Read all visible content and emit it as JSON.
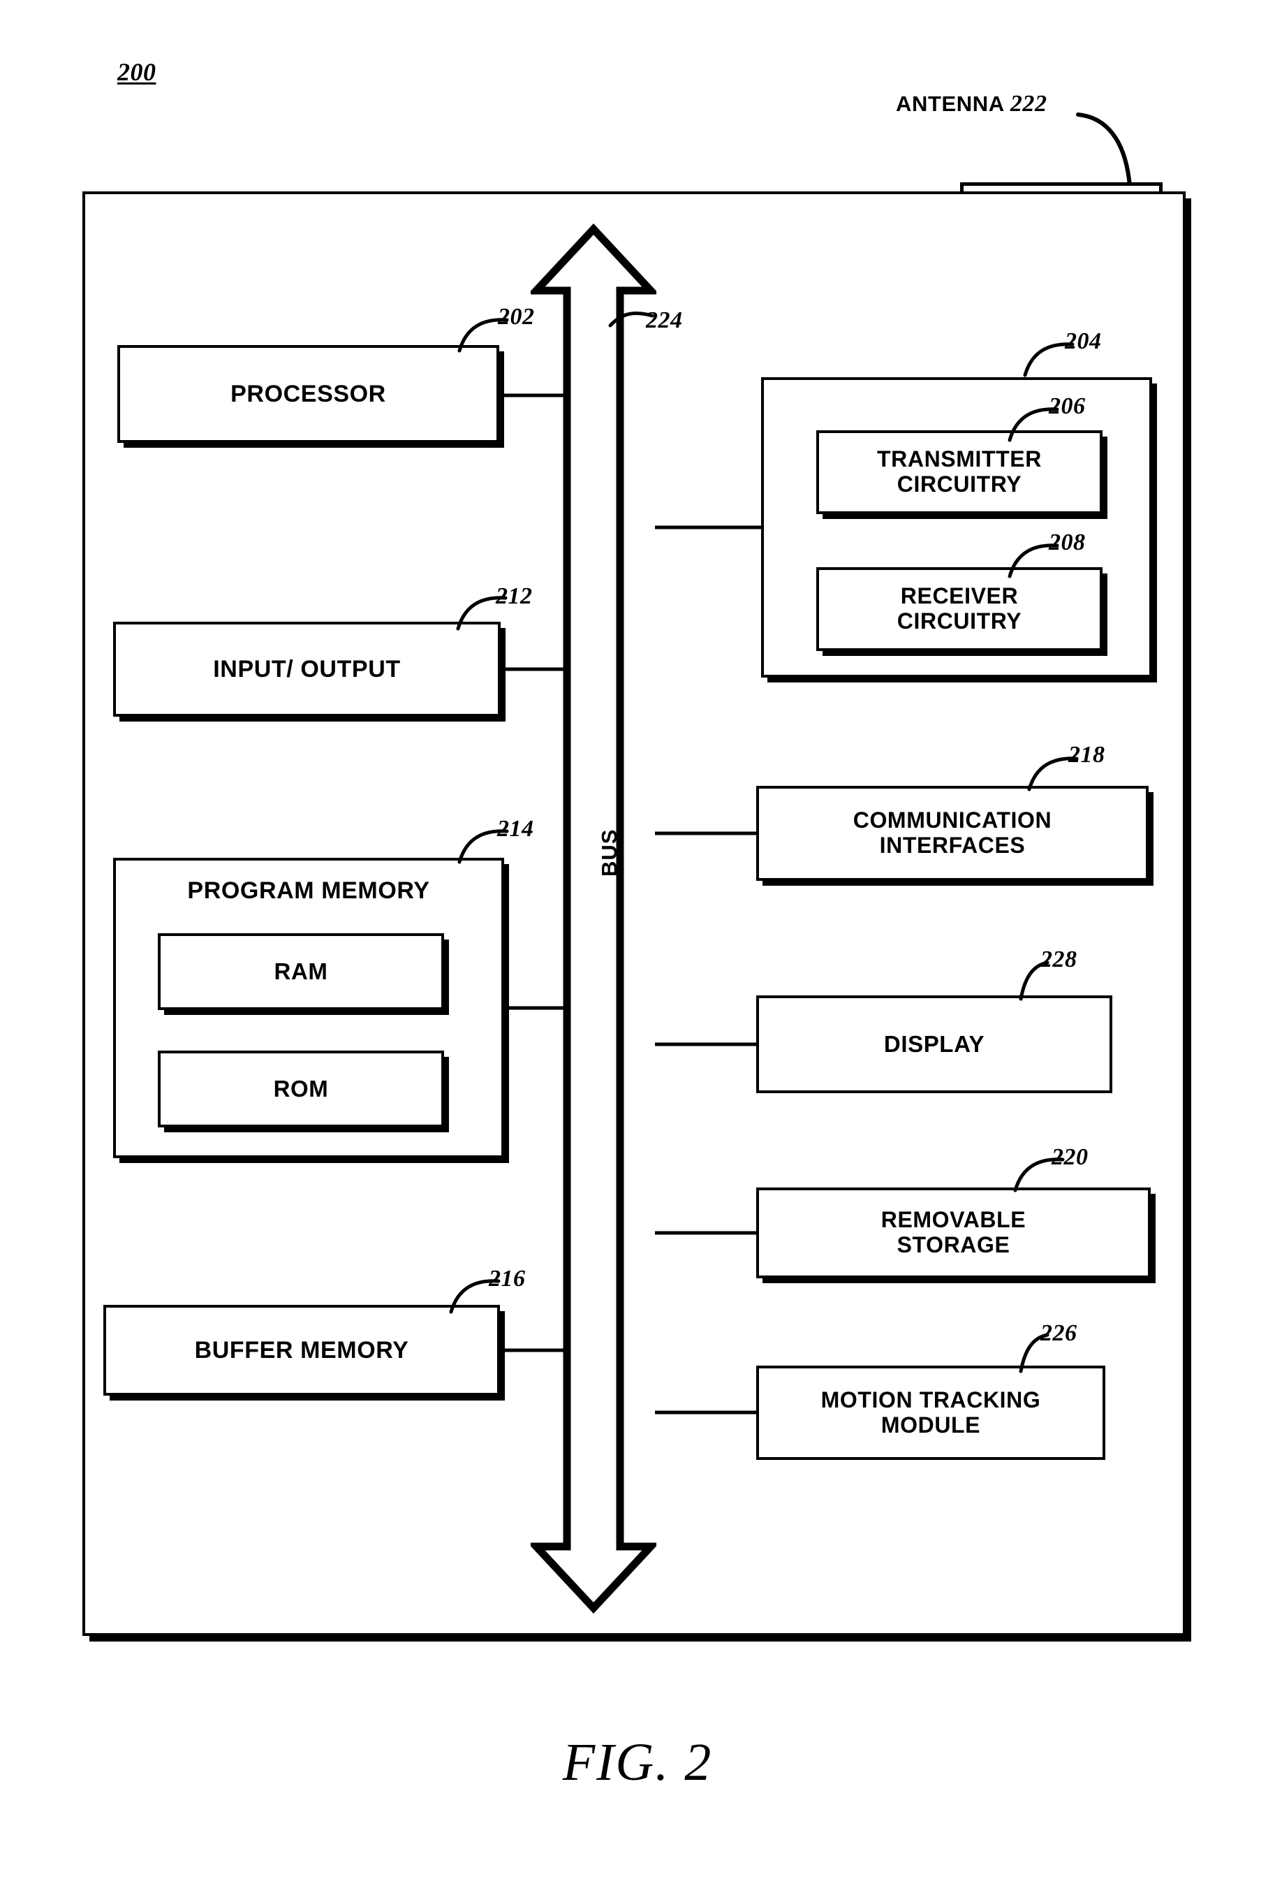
{
  "figure": {
    "number_label": "200",
    "caption": "FIG. 2"
  },
  "antenna": {
    "label": "ANTENNA",
    "ref": "222"
  },
  "bus": {
    "label": "BUS",
    "ref": "224"
  },
  "blocks": {
    "processor": {
      "label": "PROCESSOR",
      "ref": "202"
    },
    "input_output": {
      "label": "INPUT/ OUTPUT",
      "ref": "212"
    },
    "program_memory": {
      "label": "PROGRAM MEMORY",
      "ref": "214"
    },
    "ram": {
      "label": "RAM",
      "ref": ""
    },
    "rom": {
      "label": "ROM",
      "ref": ""
    },
    "buffer_memory": {
      "label": "BUFFER MEMORY",
      "ref": "216"
    },
    "radio": {
      "label": "",
      "ref": "204"
    },
    "transmitter": {
      "label": "TRANSMITTER CIRCUITRY",
      "ref": "206",
      "line1": "TRANSMITTER",
      "line2": "CIRCUITRY"
    },
    "receiver": {
      "label": "RECEIVER CIRCUITRY",
      "ref": "208",
      "line1": "RECEIVER",
      "line2": "CIRCUITRY"
    },
    "communication": {
      "label": "COMMUNICATION INTERFACES",
      "ref": "218",
      "line1": "COMMUNICATION",
      "line2": "INTERFACES"
    },
    "display": {
      "label": "DISPLAY",
      "ref": "228"
    },
    "removable_storage": {
      "label": "REMOVABLE STORAGE",
      "ref": "220",
      "line1": "REMOVABLE",
      "line2": "STORAGE"
    },
    "motion_tracking": {
      "label": "MOTION TRACKING MODULE",
      "ref": "226",
      "line1": "MOTION TRACKING",
      "line2": "MODULE"
    }
  },
  "colors": {
    "ink": "#000000",
    "paper": "#ffffff"
  }
}
